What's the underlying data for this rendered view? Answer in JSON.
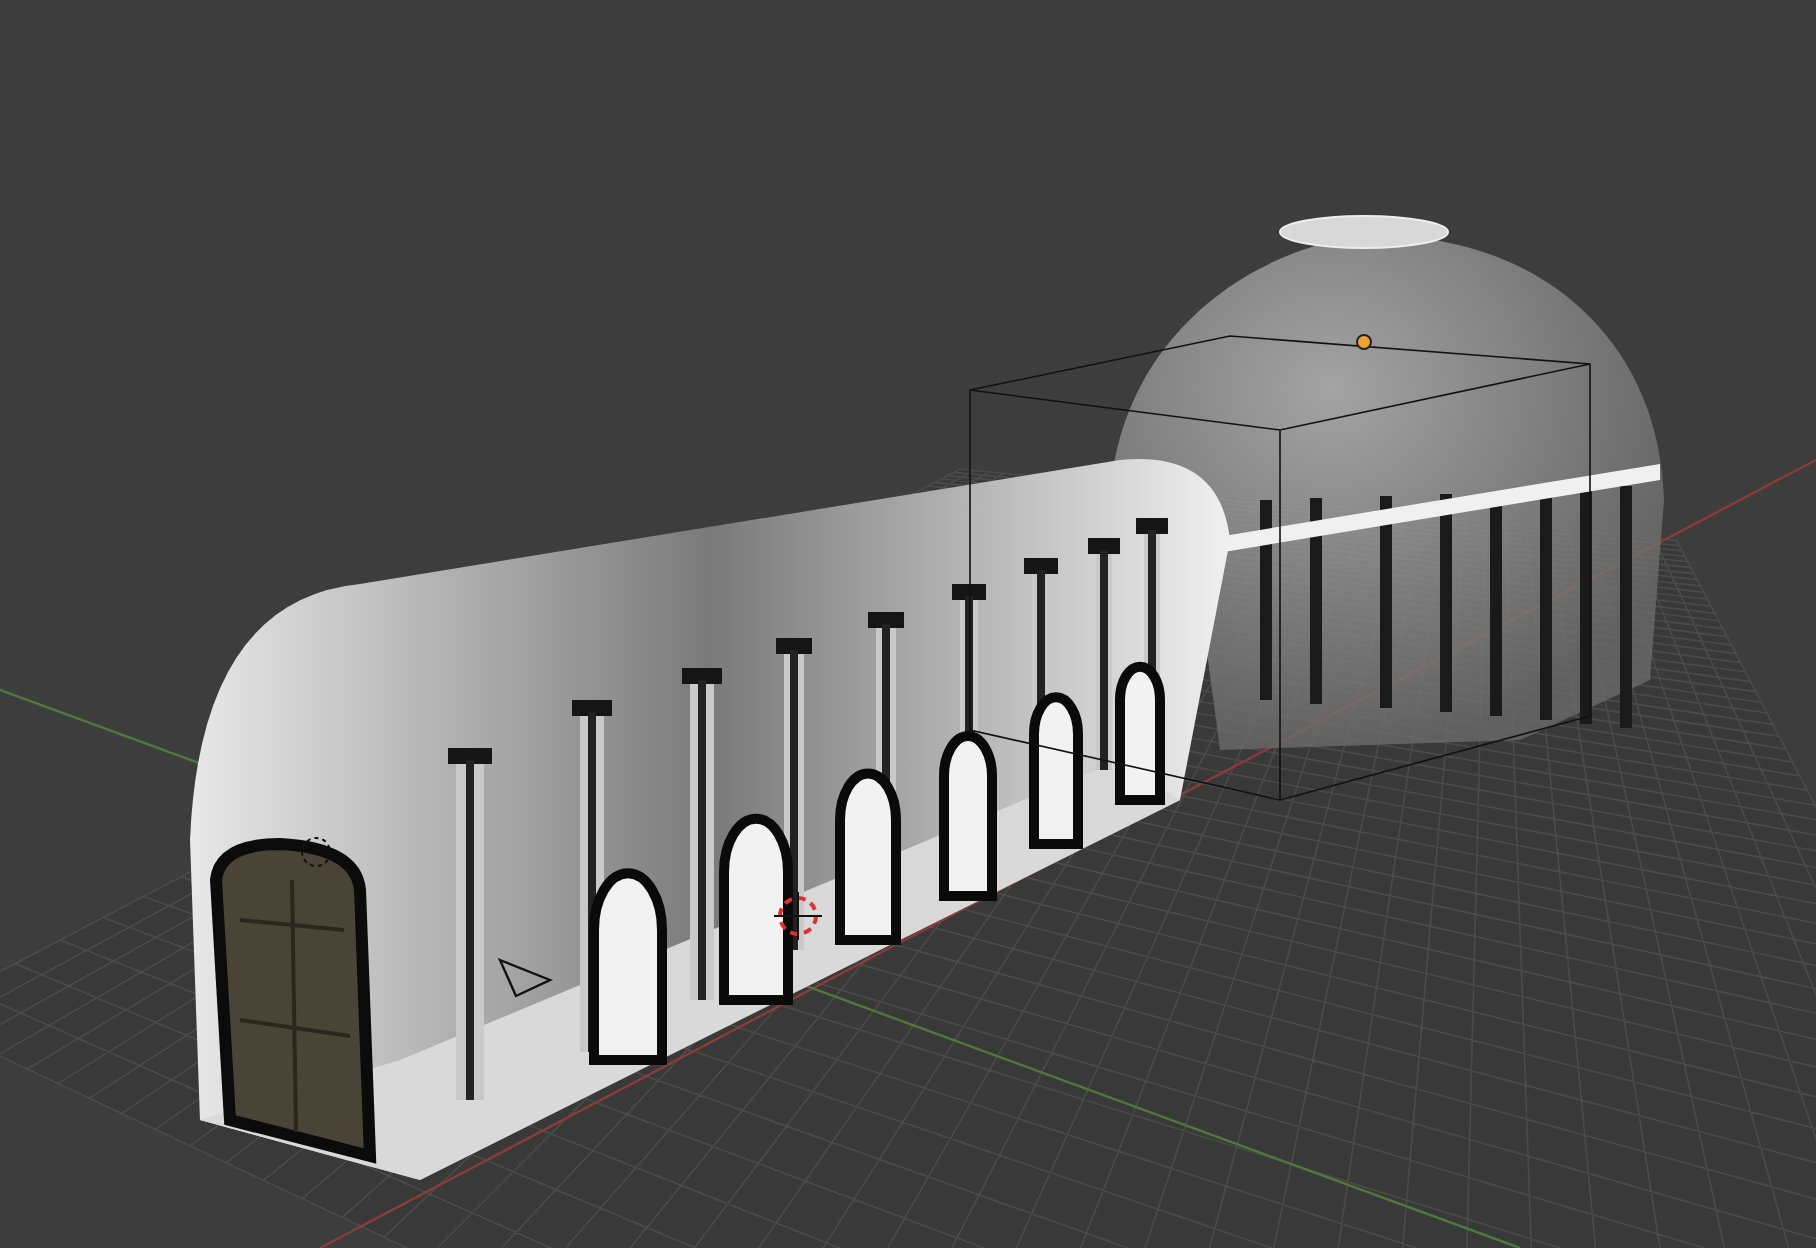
{
  "viewport": {
    "show_grid": true,
    "show_axes": true,
    "selection_outline": true
  }
}
